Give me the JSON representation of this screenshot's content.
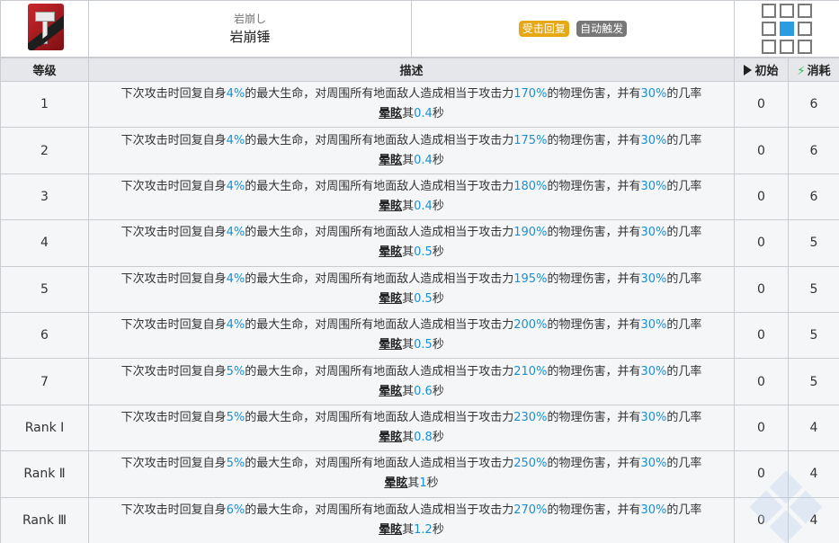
{
  "skill": {
    "icon": "hammer-icon",
    "jp_name": "岩崩し",
    "cn_name": "岩崩锤",
    "tags": [
      "受击回复",
      "自动触发"
    ]
  },
  "columns": {
    "level": "等级",
    "desc": "描述",
    "initial": "初始",
    "cost": "消耗"
  },
  "desc_template": {
    "p1": "下次攻击时回复自身",
    "p2": "的最大生命，对周围所有地面敌人造成相当于攻击力",
    "p3": "的物理伤害，并有",
    "p4": "的几率",
    "stun": "晕眩",
    "p5": "其"
  },
  "rows": [
    {
      "level": "1",
      "heal": "4%",
      "atk": "170%",
      "chance": "30%",
      "dur": "0.4",
      "unit": "秒",
      "initial": "0",
      "cost": "6"
    },
    {
      "level": "2",
      "heal": "4%",
      "atk": "175%",
      "chance": "30%",
      "dur": "0.4",
      "unit": "秒",
      "initial": "0",
      "cost": "6"
    },
    {
      "level": "3",
      "heal": "4%",
      "atk": "180%",
      "chance": "30%",
      "dur": "0.4",
      "unit": "秒",
      "initial": "0",
      "cost": "6"
    },
    {
      "level": "4",
      "heal": "4%",
      "atk": "190%",
      "chance": "30%",
      "dur": "0.5",
      "unit": "秒",
      "initial": "0",
      "cost": "5"
    },
    {
      "level": "5",
      "heal": "4%",
      "atk": "195%",
      "chance": "30%",
      "dur": "0.5",
      "unit": "秒",
      "initial": "0",
      "cost": "5"
    },
    {
      "level": "6",
      "heal": "4%",
      "atk": "200%",
      "chance": "30%",
      "dur": "0.5",
      "unit": "秒",
      "initial": "0",
      "cost": "5"
    },
    {
      "level": "7",
      "heal": "5%",
      "atk": "210%",
      "chance": "30%",
      "dur": "0.6",
      "unit": "秒",
      "initial": "0",
      "cost": "5"
    },
    {
      "level": "Rank Ⅰ",
      "heal": "5%",
      "atk": "230%",
      "chance": "30%",
      "dur": "0.8",
      "unit": "秒",
      "initial": "0",
      "cost": "4"
    },
    {
      "level": "Rank Ⅱ",
      "heal": "5%",
      "atk": "250%",
      "chance": "30%",
      "dur": "1",
      "unit": "秒",
      "initial": "0",
      "cost": "4"
    },
    {
      "level": "Rank Ⅲ",
      "heal": "6%",
      "atk": "270%",
      "chance": "30%",
      "dur": "1.2",
      "unit": "秒",
      "initial": "0",
      "cost": "4"
    }
  ],
  "colors": {
    "value_blue": "#1a8fd4",
    "tag_yellow": "#e6a817",
    "tag_gray": "#777777",
    "range_self": "#2a9de0"
  }
}
